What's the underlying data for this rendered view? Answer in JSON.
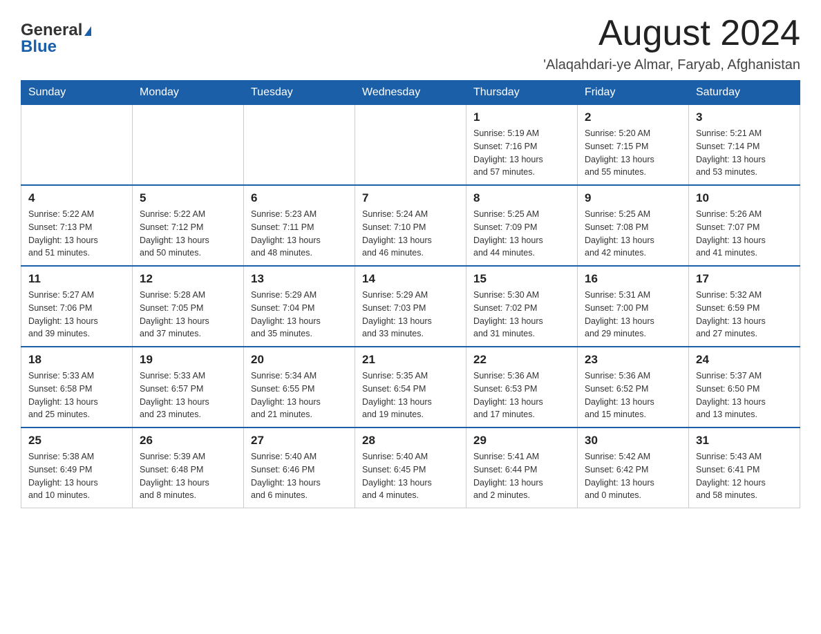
{
  "header": {
    "month_title": "August 2024",
    "location": "'Alaqahdari-ye Almar, Faryab, Afghanistan",
    "logo_general": "General",
    "logo_blue": "Blue"
  },
  "weekdays": [
    "Sunday",
    "Monday",
    "Tuesday",
    "Wednesday",
    "Thursday",
    "Friday",
    "Saturday"
  ],
  "weeks": [
    {
      "days": [
        {
          "num": "",
          "info": ""
        },
        {
          "num": "",
          "info": ""
        },
        {
          "num": "",
          "info": ""
        },
        {
          "num": "",
          "info": ""
        },
        {
          "num": "1",
          "info": "Sunrise: 5:19 AM\nSunset: 7:16 PM\nDaylight: 13 hours\nand 57 minutes."
        },
        {
          "num": "2",
          "info": "Sunrise: 5:20 AM\nSunset: 7:15 PM\nDaylight: 13 hours\nand 55 minutes."
        },
        {
          "num": "3",
          "info": "Sunrise: 5:21 AM\nSunset: 7:14 PM\nDaylight: 13 hours\nand 53 minutes."
        }
      ]
    },
    {
      "days": [
        {
          "num": "4",
          "info": "Sunrise: 5:22 AM\nSunset: 7:13 PM\nDaylight: 13 hours\nand 51 minutes."
        },
        {
          "num": "5",
          "info": "Sunrise: 5:22 AM\nSunset: 7:12 PM\nDaylight: 13 hours\nand 50 minutes."
        },
        {
          "num": "6",
          "info": "Sunrise: 5:23 AM\nSunset: 7:11 PM\nDaylight: 13 hours\nand 48 minutes."
        },
        {
          "num": "7",
          "info": "Sunrise: 5:24 AM\nSunset: 7:10 PM\nDaylight: 13 hours\nand 46 minutes."
        },
        {
          "num": "8",
          "info": "Sunrise: 5:25 AM\nSunset: 7:09 PM\nDaylight: 13 hours\nand 44 minutes."
        },
        {
          "num": "9",
          "info": "Sunrise: 5:25 AM\nSunset: 7:08 PM\nDaylight: 13 hours\nand 42 minutes."
        },
        {
          "num": "10",
          "info": "Sunrise: 5:26 AM\nSunset: 7:07 PM\nDaylight: 13 hours\nand 41 minutes."
        }
      ]
    },
    {
      "days": [
        {
          "num": "11",
          "info": "Sunrise: 5:27 AM\nSunset: 7:06 PM\nDaylight: 13 hours\nand 39 minutes."
        },
        {
          "num": "12",
          "info": "Sunrise: 5:28 AM\nSunset: 7:05 PM\nDaylight: 13 hours\nand 37 minutes."
        },
        {
          "num": "13",
          "info": "Sunrise: 5:29 AM\nSunset: 7:04 PM\nDaylight: 13 hours\nand 35 minutes."
        },
        {
          "num": "14",
          "info": "Sunrise: 5:29 AM\nSunset: 7:03 PM\nDaylight: 13 hours\nand 33 minutes."
        },
        {
          "num": "15",
          "info": "Sunrise: 5:30 AM\nSunset: 7:02 PM\nDaylight: 13 hours\nand 31 minutes."
        },
        {
          "num": "16",
          "info": "Sunrise: 5:31 AM\nSunset: 7:00 PM\nDaylight: 13 hours\nand 29 minutes."
        },
        {
          "num": "17",
          "info": "Sunrise: 5:32 AM\nSunset: 6:59 PM\nDaylight: 13 hours\nand 27 minutes."
        }
      ]
    },
    {
      "days": [
        {
          "num": "18",
          "info": "Sunrise: 5:33 AM\nSunset: 6:58 PM\nDaylight: 13 hours\nand 25 minutes."
        },
        {
          "num": "19",
          "info": "Sunrise: 5:33 AM\nSunset: 6:57 PM\nDaylight: 13 hours\nand 23 minutes."
        },
        {
          "num": "20",
          "info": "Sunrise: 5:34 AM\nSunset: 6:55 PM\nDaylight: 13 hours\nand 21 minutes."
        },
        {
          "num": "21",
          "info": "Sunrise: 5:35 AM\nSunset: 6:54 PM\nDaylight: 13 hours\nand 19 minutes."
        },
        {
          "num": "22",
          "info": "Sunrise: 5:36 AM\nSunset: 6:53 PM\nDaylight: 13 hours\nand 17 minutes."
        },
        {
          "num": "23",
          "info": "Sunrise: 5:36 AM\nSunset: 6:52 PM\nDaylight: 13 hours\nand 15 minutes."
        },
        {
          "num": "24",
          "info": "Sunrise: 5:37 AM\nSunset: 6:50 PM\nDaylight: 13 hours\nand 13 minutes."
        }
      ]
    },
    {
      "days": [
        {
          "num": "25",
          "info": "Sunrise: 5:38 AM\nSunset: 6:49 PM\nDaylight: 13 hours\nand 10 minutes."
        },
        {
          "num": "26",
          "info": "Sunrise: 5:39 AM\nSunset: 6:48 PM\nDaylight: 13 hours\nand 8 minutes."
        },
        {
          "num": "27",
          "info": "Sunrise: 5:40 AM\nSunset: 6:46 PM\nDaylight: 13 hours\nand 6 minutes."
        },
        {
          "num": "28",
          "info": "Sunrise: 5:40 AM\nSunset: 6:45 PM\nDaylight: 13 hours\nand 4 minutes."
        },
        {
          "num": "29",
          "info": "Sunrise: 5:41 AM\nSunset: 6:44 PM\nDaylight: 13 hours\nand 2 minutes."
        },
        {
          "num": "30",
          "info": "Sunrise: 5:42 AM\nSunset: 6:42 PM\nDaylight: 13 hours\nand 0 minutes."
        },
        {
          "num": "31",
          "info": "Sunrise: 5:43 AM\nSunset: 6:41 PM\nDaylight: 12 hours\nand 58 minutes."
        }
      ]
    }
  ]
}
